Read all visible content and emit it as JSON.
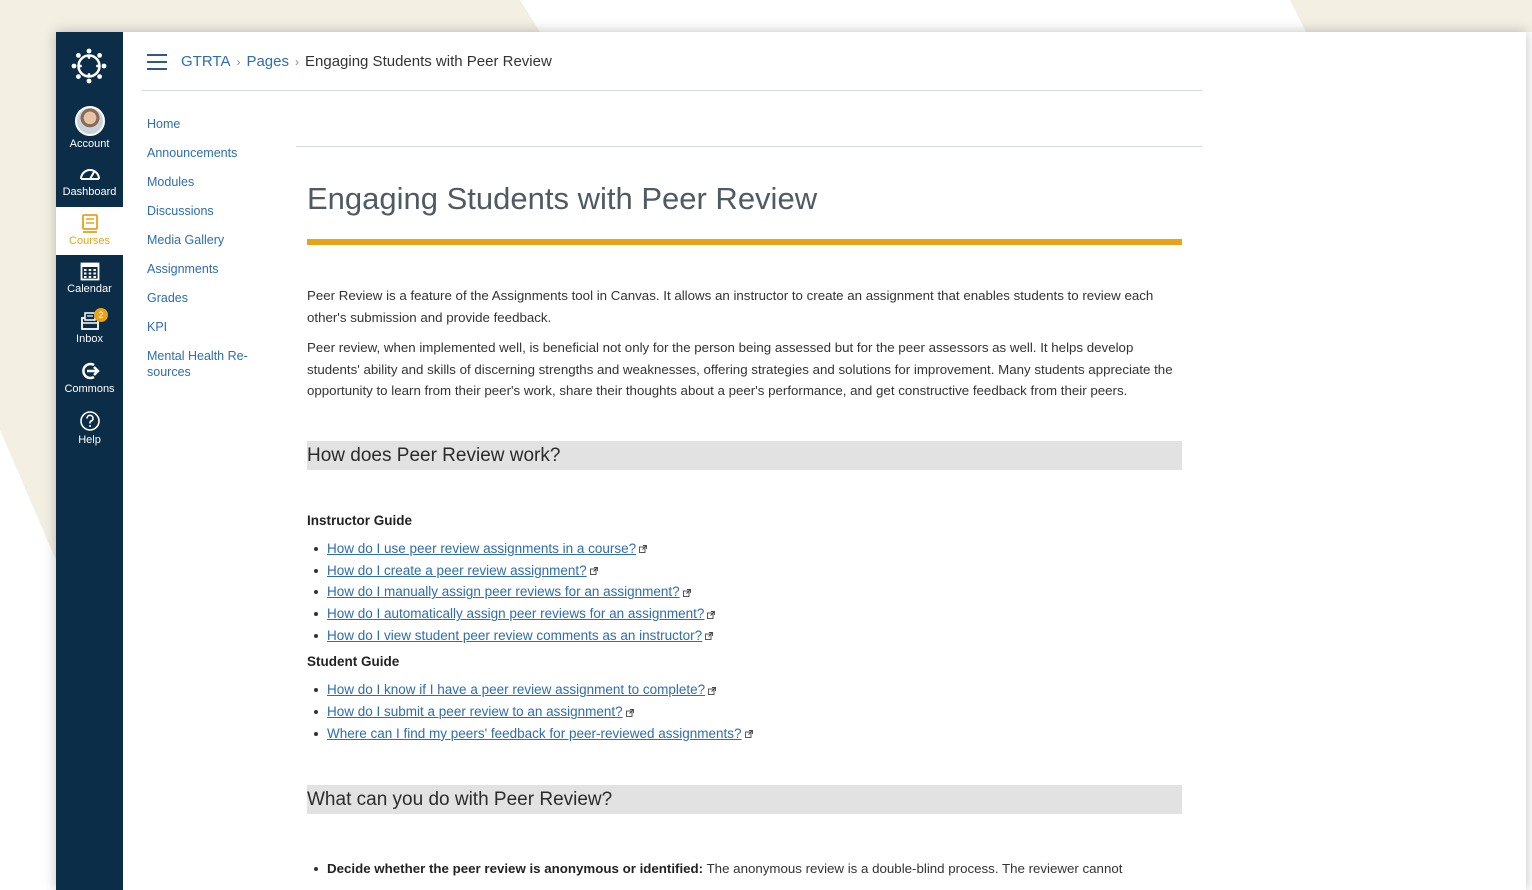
{
  "global_nav": {
    "items": [
      {
        "label": "Account",
        "icon": "avatar"
      },
      {
        "label": "Dashboard",
        "icon": "speedometer-icon"
      },
      {
        "label": "Courses",
        "icon": "book-icon",
        "active": true
      },
      {
        "label": "Calendar",
        "icon": "calendar-icon"
      },
      {
        "label": "Inbox",
        "icon": "inbox-icon",
        "badge": "2"
      },
      {
        "label": "Commons",
        "icon": "commons-icon"
      },
      {
        "label": "Help",
        "icon": "help-icon"
      }
    ]
  },
  "breadcrumb": {
    "course": "GTRTA",
    "section": "Pages",
    "current": "Engaging Students with Peer Review"
  },
  "course_nav": [
    "Home",
    "Announcements",
    "Modules",
    "Discussions",
    "Media Gallery",
    "Assignments",
    "Grades",
    "KPI",
    "Mental Health Re-\nsources"
  ],
  "page": {
    "title": "Engaging Students with Peer Review",
    "intro_p1": "Peer Review is a feature of the Assignments tool in Canvas. It allows an instructor to create an assignment that enables students to review each other's submission and provide feedback.",
    "intro_p2": "Peer review, when implemented well, is beneficial not only for the person being assessed but for the peer assessors as well. It helps develop students' ability and skills of discerning strengths and weaknesses, offering strategies and solutions for improvement. Many students appreciate the opportunity to learn from their peer's work, share their thoughts about a peer's performance, and get constructive feedback from their peers.",
    "section1_heading": "How does Peer Review work?",
    "instructor_guide_title": "Instructor Guide",
    "instructor_links": [
      "How do I use peer review assignments in a course?",
      "How do I create a peer review assignment?",
      "How do I manually assign peer reviews for an assignment?",
      "How do I automatically assign peer reviews for an assignment?",
      "How do I view student peer review comments as an instructor?"
    ],
    "student_guide_title": "Student Guide",
    "student_links": [
      "How do I know if I have a peer review assignment to complete?",
      "How do I submit a peer review to an assignment?",
      "Where can I find my peers' feedback for peer-reviewed assignments?"
    ],
    "section2_heading": "What can you do with Peer Review?",
    "feature1_bold": "Decide whether the peer review is anonymous or identified:",
    "feature1_text": " The anonymous review is a double-blind process. The reviewer cannot"
  },
  "colors": {
    "nav_bg": "#0c2d48",
    "accent": "#e8a317",
    "link": "#2d6db0",
    "backdrop": "#f3efe3"
  }
}
